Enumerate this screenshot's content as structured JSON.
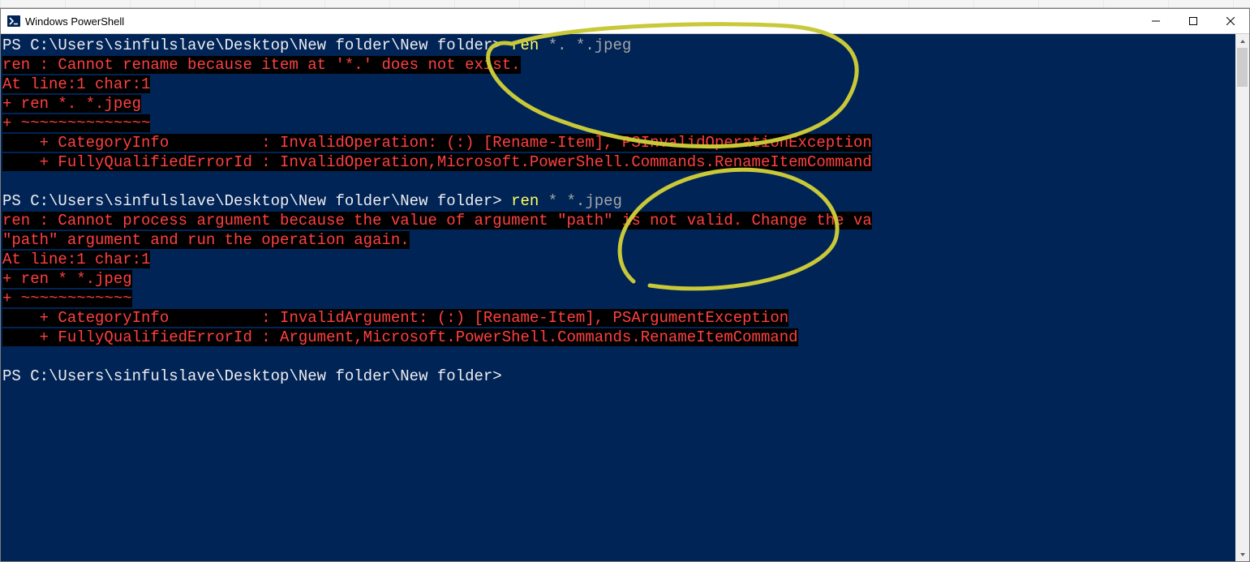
{
  "window": {
    "title": "Windows PowerShell"
  },
  "block1": {
    "prompt": "PS C:\\Users\\sinfulslave\\Desktop\\New folder\\New folder> ",
    "cmd": "ren ",
    "args": "*. *.jpeg",
    "err1": "ren : Cannot rename because item at '*.' does not exist.",
    "err2": "At line:1 char:1",
    "err3": "+ ren *. *.jpeg",
    "err4": "+ ~~~~~~~~~~~~~~",
    "err5": "    + CategoryInfo          : InvalidOperation: (:) [Rename-Item], PSInvalidOperationException",
    "err6": "    + FullyQualifiedErrorId : InvalidOperation,Microsoft.PowerShell.Commands.RenameItemCommand"
  },
  "block2": {
    "prompt": "PS C:\\Users\\sinfulslave\\Desktop\\New folder\\New folder> ",
    "cmd": "ren ",
    "arg_star": "* ",
    "arg_rest": "*.jpeg",
    "err1": "ren : Cannot process argument because the value of argument \"path\" is not valid. Change the va",
    "err2": "\"path\" argument and run the operation again.",
    "err3": "At line:1 char:1",
    "err4": "+ ren * *.jpeg",
    "err5": "+ ~~~~~~~~~~~~",
    "err6": "    + CategoryInfo          : InvalidArgument: (:) [Rename-Item], PSArgumentException",
    "err7": "    + FullyQualifiedErrorId : Argument,Microsoft.PowerShell.Commands.RenameItemCommand"
  },
  "block3": {
    "prompt": "PS C:\\Users\\sinfulslave\\Desktop\\New folder\\New folder> "
  }
}
